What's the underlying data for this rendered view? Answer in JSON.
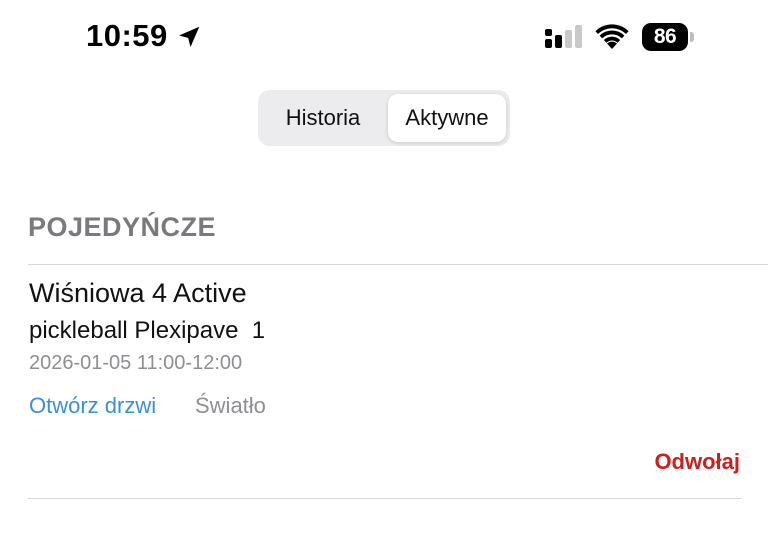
{
  "status_bar": {
    "time": "10:59",
    "battery_level": "86",
    "icons": [
      "location-arrow-icon",
      "signal-icon",
      "wifi-icon",
      "battery-icon"
    ]
  },
  "segmented_control": {
    "options": [
      "Historia",
      "Aktywne"
    ],
    "selected": "Aktywne"
  },
  "section": {
    "header": "POJEDYŃCZE"
  },
  "booking": {
    "title": "Wiśniowa 4 Active",
    "subtitle": "pickleball Plexipave  1",
    "datetime": "2026-01-05 11:00-12:00",
    "open_door_label": "Otwórz drzwi",
    "light_label": "Światło",
    "cancel_label": "Odwołaj"
  },
  "colors": {
    "link_blue": "#3d8fd4",
    "cancel_red": "#c8211e",
    "muted_gray": "#8e8e93",
    "segment_bg": "#ececee"
  }
}
